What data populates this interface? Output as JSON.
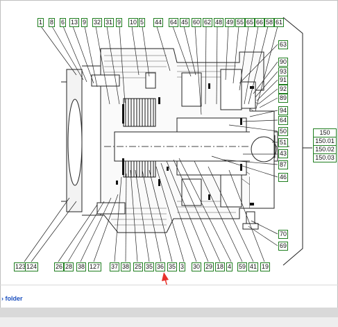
{
  "diagram": {
    "top_labels": [
      "1",
      "8",
      "6",
      "13",
      "9",
      "32",
      "31",
      "9",
      "10",
      "5",
      "44",
      "64",
      "45",
      "60",
      "62",
      "48",
      "49",
      "55",
      "65",
      "66",
      "58",
      "61"
    ],
    "right_labels": [
      "63",
      "90",
      "93",
      "91",
      "92",
      "89",
      "94",
      "64",
      "50",
      "51",
      "43",
      "87",
      "46",
      "70",
      "69"
    ],
    "group_labels": [
      "150",
      "150.01",
      "150.02",
      "150.03"
    ],
    "bottom_labels": [
      "123",
      "124",
      "26",
      "28",
      "38",
      "127",
      "37",
      "38",
      "25",
      "35",
      "36",
      "35",
      "3",
      "30",
      "29",
      "18",
      "4",
      "59",
      "41",
      "19"
    ],
    "arrow_color": "#e8322c",
    "label_border_color": "#1e7d1e"
  },
  "footer": {
    "link_text": "› folder"
  }
}
